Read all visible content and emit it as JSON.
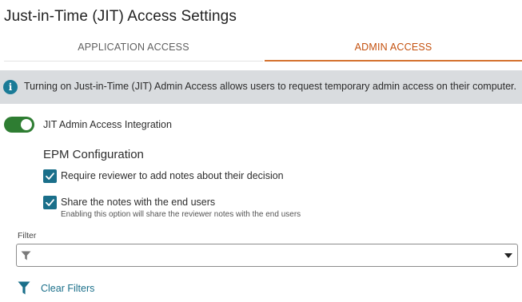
{
  "page": {
    "title": "Just-in-Time (JIT) Access Settings"
  },
  "tabs": [
    {
      "label": "APPLICATION ACCESS",
      "active": false
    },
    {
      "label": "ADMIN ACCESS",
      "active": true
    }
  ],
  "banner": {
    "icon": "info-icon",
    "text": "Turning on Just-in-Time (JIT) Admin Access allows users to request temporary admin access on their computer."
  },
  "integration": {
    "label": "JIT Admin Access Integration",
    "enabled": true
  },
  "epm": {
    "title": "EPM Configuration",
    "options": [
      {
        "label": "Require reviewer to add notes about their decision",
        "checked": true
      },
      {
        "label": "Share the notes with the end users",
        "help": "Enabling this option will share the reviewer notes with the end users",
        "checked": true
      }
    ]
  },
  "filter": {
    "label": "Filter",
    "value": "",
    "clear_label": "Clear Filters"
  },
  "colors": {
    "accent_orange": "#d4722e",
    "toggle_green": "#2e7d32",
    "teal": "#1a6f8a",
    "banner_bg": "#d9dcdf"
  }
}
